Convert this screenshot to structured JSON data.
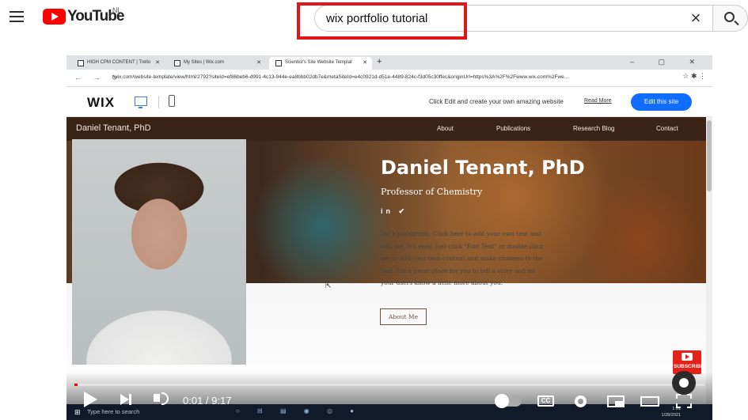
{
  "youtube": {
    "logo_text": "YouTube",
    "country_code": "NL",
    "search_query": "wix portfolio tutorial"
  },
  "browser": {
    "tabs": [
      {
        "label": "HIGH CPM CONTENT | Trello"
      },
      {
        "label": "My Sites | Wix.com"
      },
      {
        "label": "Scientist's Site Website Templat"
      }
    ],
    "url": "wix.com/website-template/view/html/2792?siteId=ef86beb6-d991-4c13-944e-ea8bbb02db7e&metaSiteId=e4c0921d-d51e-4489-824c-f3d05c30ffec&originUrl=https%3A%2F%2Fwww.wix.com%2Fwe..."
  },
  "wix": {
    "logo": "WIX",
    "message": "Click Edit and create your own amazing website",
    "read_more": "Read More",
    "edit_button": "Edit this site"
  },
  "site": {
    "name": "Daniel Tenant, PhD",
    "nav": [
      "About",
      "Publications",
      "Research Blog",
      "Contact"
    ],
    "hero_title": "Daniel Tenant, PhD",
    "hero_subtitle": "Professor of Chemistry",
    "social": "in ✔",
    "paragraph": "I'm a paragraph. Click here to add your own text and edit me. It's easy. Just click \"Edit Text\" or double click me to add your own content and make changes to the font. I'm a great place for you to tell a story and let your users know a little more about you.",
    "about_button": "About Me"
  },
  "overlay": {
    "subscribe": "SUBSCRIBE"
  },
  "taskbar": {
    "search_placeholder": "Type here to search",
    "time": "1:01",
    "date": "1/28/2021"
  },
  "player": {
    "current_time": "0:01",
    "duration": "9:17",
    "time_display": "0:01 / 9:17",
    "progress_percent": 0.2
  }
}
